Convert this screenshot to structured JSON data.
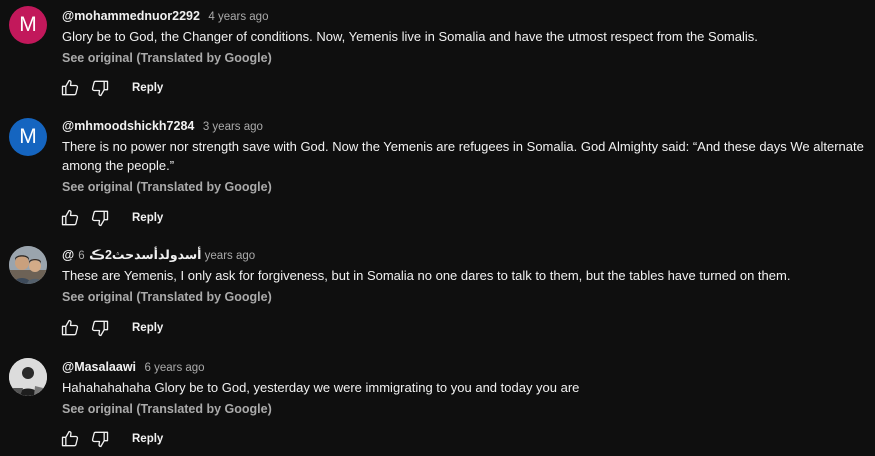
{
  "colors": {
    "background": "#0f0f0f",
    "avatar_1": "#c2185b",
    "avatar_2": "#1565c0"
  },
  "comments": [
    {
      "avatar_letter": "M",
      "handle": "@mohammednuor2292",
      "time": "4 years ago",
      "text": "Glory be to God, the Changer of conditions. Now, Yemenis live in Somalia and have the utmost respect from the Somalis.",
      "see_original": "See original (Translated by Google)",
      "reply_label": "Reply"
    },
    {
      "avatar_letter": "M",
      "handle": "@mhmoodshickh7284",
      "time": "3 years ago",
      "text": "There is no power nor strength save with God. Now the Yemenis are refugees in Somalia. God Almighty said: “And these days We alternate among the people.”",
      "see_original": "See original (Translated by Google)",
      "reply_label": "Reply"
    },
    {
      "avatar_letter": "",
      "handle": "@أسدولدأسدحث2ڪ",
      "time": "6 years ago",
      "text": "These are Yemenis, I only ask for forgiveness, but in Somalia no one dares to talk to them, but the tables have turned on them.",
      "see_original": "See original (Translated by Google)",
      "reply_label": "Reply"
    },
    {
      "avatar_letter": "",
      "handle": "@Masalaawi",
      "time": "6 years ago",
      "text": "Hahahahahaha Glory be to God, yesterday we were immigrating to you and today you are",
      "see_original": "See original (Translated by Google)",
      "reply_label": "Reply"
    }
  ]
}
